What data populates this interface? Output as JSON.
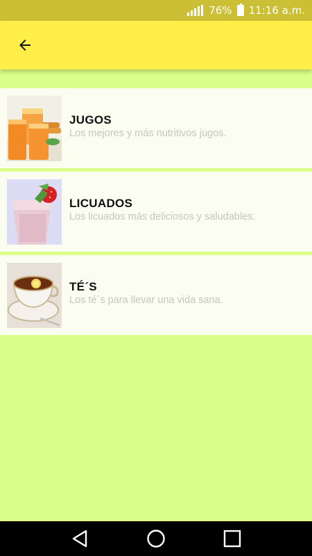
{
  "status_bar": {
    "battery_percent": "76%",
    "time": "11:16 a.m."
  },
  "app_bar": {
    "back_icon": "arrow-left-icon"
  },
  "categories": [
    {
      "title": "JUGOS",
      "description": "Los mejores y más nutritivos jugos.",
      "image": "orange-juice-glasses"
    },
    {
      "title": "LICUADOS",
      "description": "Los licuados más deliciosos y saludables.",
      "image": "strawberry-smoothie"
    },
    {
      "title": "TÉ´S",
      "description": "Los té´s para llevar una vida sana.",
      "image": "tea-cup-with-lemon"
    }
  ],
  "colors": {
    "status_bar": "#cbbf35",
    "app_bar": "#ffee4a",
    "background": "#dbff88",
    "card": "#fbfdf0",
    "description_text": "#c4c7bd"
  },
  "nav_bar": {
    "buttons": [
      "back-triangle-icon",
      "home-circle-icon",
      "recents-square-icon"
    ]
  }
}
